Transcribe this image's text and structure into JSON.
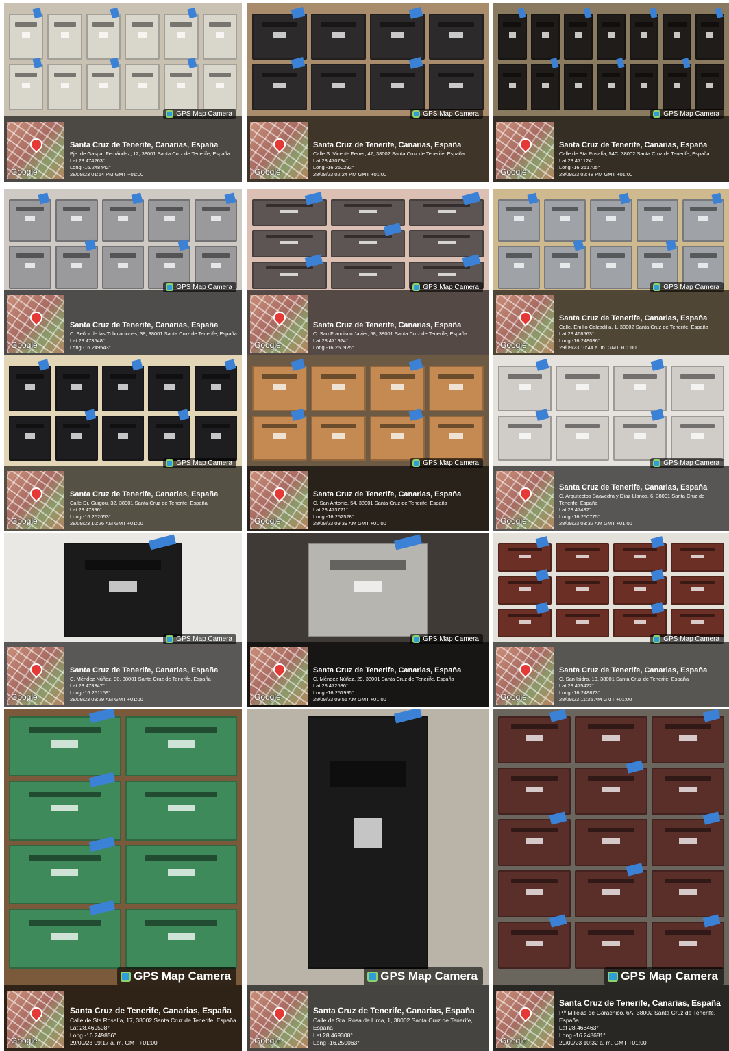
{
  "badge_label": "GPS Map Camera",
  "map_label": "Google",
  "tiles": [
    {
      "title": "Santa Cruz de Tenerife, Canarias, España",
      "address": "Pje. de Gaspar Fernández, 12, 38001 Santa Cruz de Tenerife, España",
      "lat": "Lat 28.474263°",
      "long": "Long -16.248442°",
      "datetime": "28/09/23 01:54 PM GMT +01:00",
      "bg": "#c9c1b2",
      "box": "#d9d6cc",
      "cols": 6,
      "rows": 2
    },
    {
      "title": "Santa Cruz de Tenerife, Canarias, España",
      "address": "Calle S. Vicente Ferrer, 47, 38002 Santa Cruz de Tenerife, España",
      "lat": "Lat 28.470734°",
      "long": "Long -16.250292°",
      "datetime": "28/09/23 02:24 PM GMT +01:00",
      "bg": "#a88c6c",
      "box": "#2c2a2b",
      "cols": 4,
      "rows": 2
    },
    {
      "title": "Santa Cruz de Tenerife, Canarias, España",
      "address": "Calle de Sta Rosalía, 54C, 38002 Santa Cruz de Tenerife, España",
      "lat": "Lat 28.471124°",
      "long": "Long -16.251705°",
      "datetime": "28/09/23 02:48 PM GMT +01:00",
      "bg": "#8a7a60",
      "box": "#1f1c1a",
      "cols": 7,
      "rows": 2
    },
    {
      "title": "Santa Cruz de Tenerife, Canarias, España",
      "address": "C. Señor de las Tribulaciones, 38, 38001 Santa Cruz de Tenerife, España",
      "lat": "Lat 28.473548°",
      "long": "Long -16.249543°",
      "datetime": "",
      "bg": "#cfcac4",
      "box": "#9a9a9c",
      "cols": 5,
      "rows": 2
    },
    {
      "title": "Santa Cruz de Tenerife, Canarias, España",
      "address": "C. San Francisco Javier, 58, 38001 Santa Cruz de Tenerife, España",
      "lat": "Lat 28.471924°",
      "long": "Long -16.250925°",
      "datetime": "",
      "bg": "#dcc0b4",
      "box": "#5d5553",
      "cols": 3,
      "rows": 3
    },
    {
      "title": "Santa Cruz de Tenerife, Canarias, España",
      "address": "Calle, Emilio Calzadilla, 1, 38002 Santa Cruz de Tenerife, España",
      "lat": "Lat 28.468563°",
      "long": "Long -16.248036°",
      "datetime": "29/09/23 10:44 a. m. GMT +01:00",
      "bg": "#cfb98f",
      "box": "#9fa2a6",
      "cols": 5,
      "rows": 2
    },
    {
      "title": "Santa Cruz de Tenerife, Canarias, España",
      "address": "Calle Dr. Guigou, 32, 38001 Santa Cruz de Tenerife, España",
      "lat": "Lat 28.47396°",
      "long": "Long -16.252653°",
      "datetime": "28/09/23 10:26 AM GMT +01:00",
      "bg": "#e3d6b6",
      "box": "#1e1e20",
      "cols": 5,
      "rows": 2
    },
    {
      "title": "Santa Cruz de Tenerife, Canarias, España",
      "address": "C. San Antonio, 54, 38001 Santa Cruz de Tenerife, España",
      "lat": "Lat 28.473721°",
      "long": "Long -16.252528°",
      "datetime": "28/09/23 09:39 AM GMT +01:00",
      "bg": "#6d5a44",
      "box": "#c48a52",
      "cols": 4,
      "rows": 2
    },
    {
      "title": "Santa Cruz de Tenerife, Canarias, España",
      "address": "C. Arquitectos Saavedra y Díaz-Llanos, 6, 38001 Santa Cruz de Tenerife, España",
      "lat": "Lat 28.47432°",
      "long": "Long -16.250775°",
      "datetime": "28/09/23 08:32 AM GMT +01:00",
      "bg": "#e6e3df",
      "box": "#d0cdc8",
      "cols": 4,
      "rows": 2
    },
    {
      "title": "Santa Cruz de Tenerife, Canarias, España",
      "address": "C. Méndez Núñez, 90, 38001 Santa Cruz de Tenerife, España",
      "lat": "Lat 28.473347°",
      "long": "Long -16.251159°",
      "datetime": "28/09/23 09:29 AM GMT +01:00",
      "bg": "#e9e8e4",
      "box": "#1b1b1c",
      "cols": 1,
      "rows": 1
    },
    {
      "title": "Santa Cruz de Tenerife, Canarias, España",
      "address": "C. Méndez Núñez, 29, 38001 Santa Cruz de Tenerife, España",
      "lat": "Lat 28.472586°",
      "long": "Long -16.251995°",
      "datetime": "28/09/23 09:55 AM GMT +01:00",
      "bg": "#3f3a36",
      "box": "#b7b5b0",
      "cols": 1,
      "rows": 1
    },
    {
      "title": "Santa Cruz de Tenerife, Canarias, España",
      "address": "C. San Isidro, 13, 38001 Santa Cruz de Tenerife, España",
      "lat": "Lat 28.475422°",
      "long": "Long -16.248873°",
      "datetime": "28/09/23 11:35 AM GMT +01:00",
      "bg": "#e4e1db",
      "box": "#6b2f25",
      "cols": 4,
      "rows": 3
    },
    {
      "title": "Santa Cruz de Tenerife, Canarias, España",
      "address": "Calle de Sta Rosalía, 17, 38002 Santa Cruz de Tenerife, España",
      "lat": "Lat 28.469508°",
      "long": "Long -16.249856°",
      "datetime": "29/09/23 09:17 a. m. GMT +01:00",
      "bg": "#7b5a3c",
      "box": "#3f8a5a",
      "cols": 2,
      "rows": 4
    },
    {
      "title": "Santa Cruz de Tenerife, Canarias, España",
      "address": "Calle de Sta. Rosa de Lima, 1, 38002 Santa Cruz de Tenerife, España",
      "lat": "Lat 28.469308°",
      "long": "Long -16.250063°",
      "datetime": "",
      "bg": "#b9b3a8",
      "box": "#1a1a1a",
      "cols": 1,
      "rows": 1
    },
    {
      "title": "Santa Cruz de Tenerife, Canarias, España",
      "address": "P.º Milicias de Garachico, 6A, 38002 Santa Cruz de Tenerife, España",
      "lat": "Lat 28.468463°",
      "long": "Long -16.248681°",
      "datetime": "29/09/23 10:32 a. m. GMT +01:00",
      "bg": "#6a665e",
      "box": "#5a2f2a",
      "cols": 3,
      "rows": 5
    }
  ]
}
